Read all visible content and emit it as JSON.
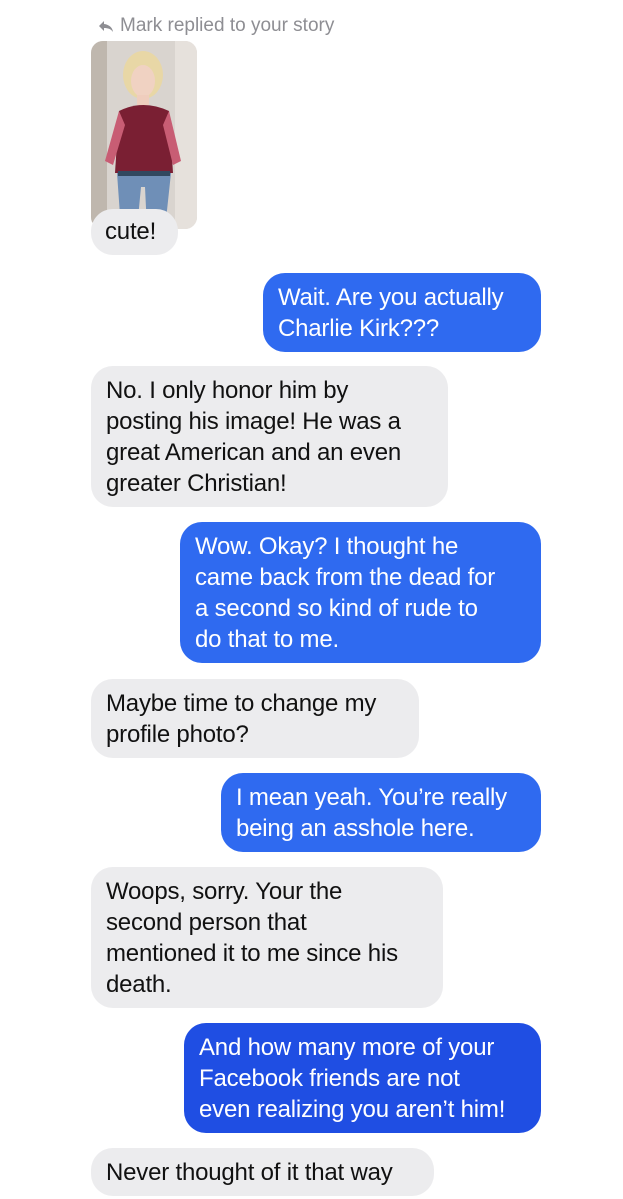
{
  "story_reply": {
    "header": "Mark replied to your story",
    "reply": "cute!"
  },
  "messages": [
    {
      "direction": "outgoing",
      "lines": [
        "Wait. Are you actually",
        "Charlie Kirk???"
      ]
    },
    {
      "direction": "incoming",
      "lines": [
        "No. I only honor him by",
        "posting his image!  He was a",
        "great American and an even",
        "greater Christian!"
      ]
    },
    {
      "direction": "outgoing",
      "lines": [
        "Wow. Okay? I thought he",
        "came back from the dead for",
        "a second so kind of rude to",
        "do that to me."
      ]
    },
    {
      "direction": "incoming",
      "lines": [
        "Maybe time to change my",
        "profile photo?"
      ]
    },
    {
      "direction": "outgoing",
      "lines": [
        "I mean yeah. You’re really",
        "being an asshole here."
      ]
    },
    {
      "direction": "incoming",
      "lines": [
        "Woops,  sorry.  Your the",
        "second person that",
        "mentioned it to me since his",
        "death."
      ]
    },
    {
      "direction": "outgoing",
      "lines": [
        "And how many more of your",
        "Facebook friends are not",
        "even realizing you aren’t him!"
      ]
    },
    {
      "direction": "incoming",
      "lines": [
        "Never thought of it that way"
      ]
    }
  ],
  "colors": {
    "outgoing_bubble": "#2f6af0",
    "incoming_bubble": "#ececee",
    "header_text": "#8e8e93"
  }
}
